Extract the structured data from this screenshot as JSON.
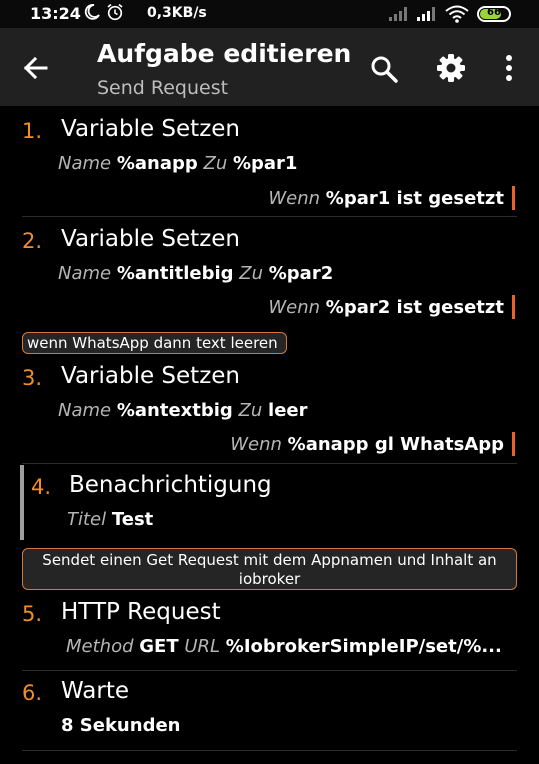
{
  "status_bar": {
    "time": "13:24",
    "speed": "0,3KB/s",
    "battery": "66",
    "battery_color": "#9cd33c"
  },
  "app_bar": {
    "title": "Aufgabe editieren",
    "subtitle": "Send Request",
    "icons": [
      "back-arrow-icon",
      "search-icon",
      "gear-icon",
      "more-vertical-icon"
    ]
  },
  "accent_colors": {
    "number": "#ef8f2a",
    "condition_bar": "#e8642c",
    "comment_border": "#cf7a3c"
  },
  "actions": [
    {
      "number": "1.",
      "name": "Variable Setzen",
      "params": [
        {
          "label": "Name",
          "value": "%anapp"
        },
        {
          "label": "Zu",
          "value": "%par1"
        }
      ],
      "condition": {
        "label": "Wenn",
        "value": "%par1 ist gesetzt"
      }
    },
    {
      "number": "2.",
      "name": "Variable Setzen",
      "params": [
        {
          "label": "Name",
          "value": "%antitlebig"
        },
        {
          "label": "Zu",
          "value": "%par2"
        }
      ],
      "condition": {
        "label": "Wenn",
        "value": "%par2 ist gesetzt"
      }
    },
    {
      "comment": "wenn WhatsApp dann text leeren",
      "number": "3.",
      "name": "Variable Setzen",
      "params": [
        {
          "label": "Name",
          "value": "%antextbig"
        },
        {
          "label": "Zu",
          "value": "leer"
        }
      ],
      "condition": {
        "label": "Wenn",
        "value": "%anapp gl WhatsApp"
      }
    },
    {
      "number": "4.",
      "name": "Benachrichtigung",
      "params": [
        {
          "label": "Titel",
          "value": "Test"
        }
      ]
    },
    {
      "comment": "Sendet einen Get Request mit dem Appnamen und Inhalt an iobroker",
      "number": "5.",
      "name": "HTTP Request",
      "params": [
        {
          "label": "Method",
          "value": "GET"
        },
        {
          "label": "URL",
          "value": "%IobrokerSimpleIP/set/%..."
        }
      ]
    },
    {
      "number": "6.",
      "name": "Warte",
      "params": [
        {
          "label": "",
          "value": "8 Sekunden"
        }
      ]
    }
  ]
}
